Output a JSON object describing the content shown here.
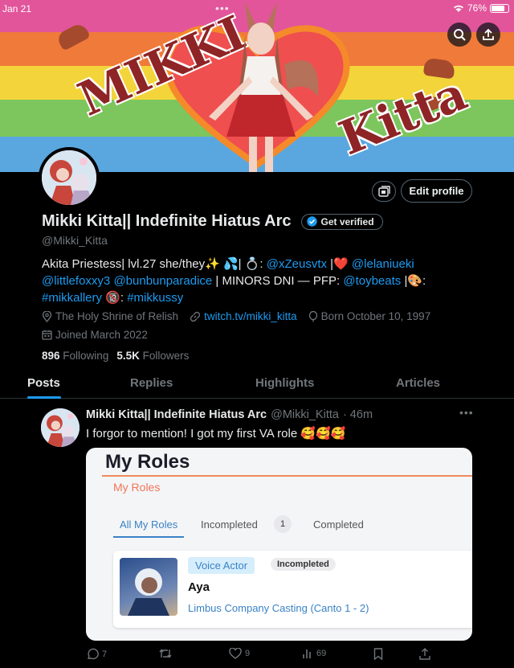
{
  "status_bar": {
    "time": "Jan 21",
    "battery": "76%"
  },
  "banner": {
    "word1": "MIKKI",
    "word2": "Kitta"
  },
  "profile": {
    "display_name": "Mikki Kitta|| Indefinite Hiatus Arc",
    "verify_label": "Get verified",
    "handle": "@Mikki_Kitta",
    "edit_label": "Edit profile",
    "bio": {
      "l1_a": "Akita Priestess| lvl.27 she/they✨ 💦| 💍: ",
      "l1_link1": "@xZeusvtx",
      "l1_b": " |❤️ ",
      "l1_link2": "@lelaniueki",
      "l2_link1": "@littlefoxxy3",
      "l2_sp": " ",
      "l2_link2": "@bunbunparadice",
      "l2_a": " | MINORS DNI — PFP: ",
      "l2_link3": "@toybeats",
      "l2_b": " |🎨:",
      "l3_link1": "#mikkallery",
      "l3_a": " 🔞: ",
      "l3_link2": "#mikkussy"
    },
    "location": "The Holy Shrine of Relish",
    "website": "twitch.tv/mikki_kitta",
    "birthday": "Born October 10, 1997",
    "joined": "Joined March 2022",
    "following_count": "896",
    "following_label": "Following",
    "followers_count": "5.5K",
    "followers_label": "Followers"
  },
  "tabs": [
    "Posts",
    "Replies",
    "Highlights",
    "Articles"
  ],
  "post": {
    "name": "Mikki Kitta|| Indefinite Hiatus Arc",
    "handle": "@Mikki_Kitta",
    "time": "· 46m",
    "text": "I forgor to mention! I got my first VA role 🥰🥰🥰",
    "media": {
      "title": "My Roles",
      "subtitle": "My Roles",
      "tab_all": "All My Roles",
      "tab_incompleted": "Incompleted",
      "incompleted_count": "1",
      "tab_completed": "Completed",
      "badge_role": "Voice Actor",
      "badge_status": "Incompleted",
      "role_name": "Aya",
      "casting": "Limbus Company Casting (Canto 1 - 2)"
    },
    "replies": "7",
    "reposts": "",
    "likes": "9",
    "views": "69"
  },
  "colors": {
    "accent": "#1d9bf0",
    "background": "#000000",
    "muted": "#71767b"
  }
}
